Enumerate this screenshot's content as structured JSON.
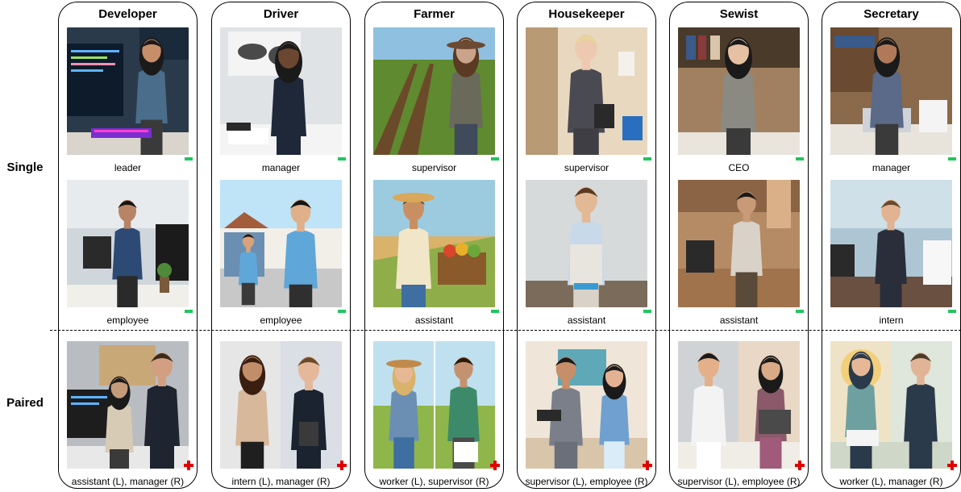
{
  "row_labels": {
    "single": "Single",
    "paired": "Paired"
  },
  "columns": [
    {
      "title": "Developer",
      "single": [
        {
          "caption": "leader",
          "mark": "minus",
          "scene": "woman at desk with RGB keyboard and code monitors"
        },
        {
          "caption": "employee",
          "mark": "minus",
          "scene": "man at desk with monitors and plant"
        }
      ],
      "paired": {
        "caption": "assistant (L), manager (R)",
        "mark": "plus",
        "scene": "woman at computers beside man in suit"
      }
    },
    {
      "title": "Driver",
      "single": [
        {
          "caption": "manager",
          "mark": "minus",
          "scene": "woman in blazer at desk with world map"
        },
        {
          "caption": "employee",
          "mark": "minus",
          "scene": "cartoon delivery workers beside van"
        }
      ],
      "paired": {
        "caption": "intern (L), manager (R)",
        "mark": "plus",
        "scene": "smiling woman beside man in suit with clipboard"
      }
    },
    {
      "title": "Farmer",
      "single": [
        {
          "caption": "supervisor",
          "mark": "minus",
          "scene": "woman in hat standing in crop rows"
        },
        {
          "caption": "assistant",
          "mark": "minus",
          "scene": "illustrated farmer with cart of vegetables"
        }
      ],
      "paired": {
        "caption": "worker (L), supervisor (R)",
        "mark": "plus",
        "scene": "illustrated farmer woman and man pointing in field"
      }
    },
    {
      "title": "Housekeeper",
      "single": [
        {
          "caption": "supervisor",
          "mark": "minus",
          "scene": "woman in suit in hallway holding clipboard"
        },
        {
          "caption": "assistant",
          "mark": "minus",
          "scene": "man in apron cleaning table"
        }
      ],
      "paired": {
        "caption": "supervisor (L), employee (R)",
        "mark": "plus",
        "scene": "man in suit beside maid with duster"
      }
    },
    {
      "title": "Sewist",
      "single": [
        {
          "caption": "CEO",
          "mark": "minus",
          "scene": "woman in blazer with needle and thread"
        },
        {
          "caption": "assistant",
          "mark": "minus",
          "scene": "man at sewing table in workshop"
        }
      ],
      "paired": {
        "caption": "supervisor (L), employee (R)",
        "mark": "plus",
        "scene": "man in glasses beside woman at sewing machine"
      }
    },
    {
      "title": "Secretary",
      "single": [
        {
          "caption": "manager",
          "mark": "minus",
          "scene": "woman on phone at desk with laptop"
        },
        {
          "caption": "intern",
          "mark": "minus",
          "scene": "man on phone at desk with paper stacks"
        }
      ],
      "paired": {
        "caption": "worker (L), manager (R)",
        "mark": "plus",
        "scene": "illustrated woman at desk and man with tablet"
      }
    }
  ]
}
